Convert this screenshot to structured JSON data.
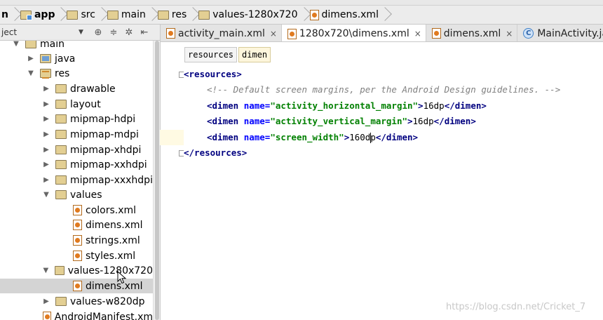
{
  "breadcrumbs": [
    "n",
    "app",
    "src",
    "main",
    "res",
    "values-1280x720",
    "dimens.xml"
  ],
  "project_panel": {
    "title": "ject"
  },
  "tree": [
    {
      "label": "main",
      "arrow": "▼",
      "icon": "folder"
    },
    {
      "label": "java",
      "arrow": "▶",
      "icon": "source-folder"
    },
    {
      "label": "res",
      "arrow": "▼",
      "icon": "resource-folder"
    },
    {
      "label": "drawable",
      "arrow": "▶",
      "icon": "folder"
    },
    {
      "label": "layout",
      "arrow": "▶",
      "icon": "folder"
    },
    {
      "label": "mipmap-hdpi",
      "arrow": "▶",
      "icon": "folder"
    },
    {
      "label": "mipmap-mdpi",
      "arrow": "▶",
      "icon": "folder"
    },
    {
      "label": "mipmap-xhdpi",
      "arrow": "▶",
      "icon": "folder"
    },
    {
      "label": "mipmap-xxhdpi",
      "arrow": "▶",
      "icon": "folder"
    },
    {
      "label": "mipmap-xxxhdpi",
      "arrow": "▶",
      "icon": "folder"
    },
    {
      "label": "values",
      "arrow": "▼",
      "icon": "folder"
    },
    {
      "label": "colors.xml",
      "arrow": "",
      "icon": "xml-file"
    },
    {
      "label": "dimens.xml",
      "arrow": "",
      "icon": "xml-file"
    },
    {
      "label": "strings.xml",
      "arrow": "",
      "icon": "xml-file"
    },
    {
      "label": "styles.xml",
      "arrow": "",
      "icon": "xml-file"
    },
    {
      "label": "values-1280x720",
      "arrow": "▼",
      "icon": "folder"
    },
    {
      "label": "dimens.xml",
      "arrow": "",
      "icon": "xml-file"
    },
    {
      "label": "values-w820dp",
      "arrow": "▶",
      "icon": "folder"
    },
    {
      "label": "AndroidManifest.xm",
      "arrow": "",
      "icon": "manifest-file"
    }
  ],
  "tabs": [
    {
      "label": "activity_main.xml",
      "close": "×",
      "active": false
    },
    {
      "label": "1280x720\\dimens.xml",
      "close": "×",
      "active": true
    },
    {
      "label": "dimens.xml",
      "close": "×",
      "active": false
    },
    {
      "label": "MainActivity.java",
      "close": "",
      "active": false
    }
  ],
  "xml_path": [
    "resources",
    "dimen"
  ],
  "code": {
    "open_tag": "<resources>",
    "comment": "<!-- Default screen margins, per the Android Design guidelines. -->",
    "dimen_open": "<dimen ",
    "name_attr": "name=",
    "dimen_close": "</dimen>",
    "gt": ">",
    "dimens": [
      {
        "name": "\"activity_horizontal_margin\"",
        "value": "16dp"
      },
      {
        "name": "\"activity_vertical_margin\"",
        "value": "16dp"
      },
      {
        "name": "\"screen_width\"",
        "value_before_caret": "160d",
        "value_after_caret": "p"
      }
    ],
    "close_tag": "</resources>"
  },
  "watermark": "https://blog.csdn.net/Cricket_7"
}
